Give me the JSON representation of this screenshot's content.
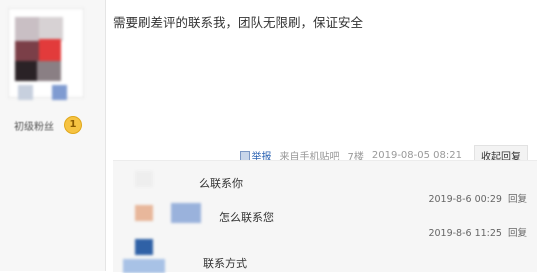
{
  "author": {
    "level": "初级粉丝",
    "level_badge": "1"
  },
  "post": {
    "text": "需要刷差评的联系我，团队无限刷，保证安全",
    "report_label": "举报",
    "source": "来自手机贴吧",
    "floor": "7楼",
    "timestamp": "2019-08-05 08:21",
    "collapse_label": "收起回复"
  },
  "replies": [
    {
      "text": "么联系你",
      "time": "2019-8-6 00:29",
      "reply_label": "回复"
    },
    {
      "text": "怎么联系您",
      "time": "2019-8-6 11:25",
      "reply_label": "回复"
    },
    {
      "text": "联系方式"
    }
  ],
  "colors": {
    "link_blue": "#2d64b3",
    "badge_gold": "#f6c342",
    "reply_bg": "#f6f6f6"
  }
}
